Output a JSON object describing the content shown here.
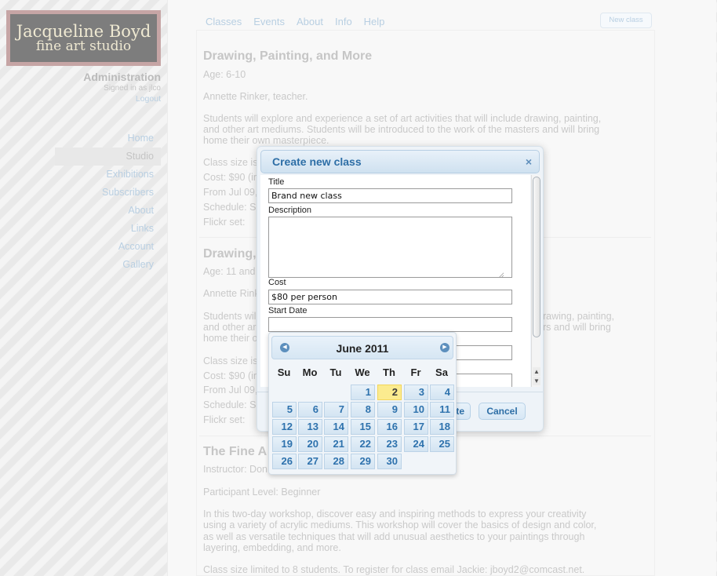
{
  "logo": {
    "line1": "Jacqueline Boyd",
    "line2": "fine art studio"
  },
  "admin": {
    "title": "Administration",
    "signed_in": "Signed in as jlco",
    "logout": "Logout"
  },
  "sidebar": {
    "items": [
      {
        "label": "Home",
        "active": false
      },
      {
        "label": "Studio",
        "active": true
      },
      {
        "label": "Exhibitions",
        "active": false
      },
      {
        "label": "Subscribers",
        "active": false
      },
      {
        "label": "About",
        "active": false
      },
      {
        "label": "Links",
        "active": false
      },
      {
        "label": "Account",
        "active": false
      },
      {
        "label": "Gallery",
        "active": false
      }
    ]
  },
  "topnav": {
    "items": [
      "Classes",
      "Events",
      "About",
      "Info",
      "Help"
    ],
    "new_class_button": "New class"
  },
  "content": {
    "class1": {
      "title": "Drawing, Painting, and More",
      "age": "Age: 6-10",
      "teacher": "Annette Rinker, teacher.",
      "desc1": "Students will explore and experience a set of art activities that will include drawing, painting,",
      "desc2": "and other art mediums. Students will be introduced to the work of the masters and will bring",
      "desc3": "home their own masterpiece.",
      "size": "Class size is",
      "cost": "Cost: $90 (in",
      "from": "From Jul 09,",
      "schedule": "Schedule: S",
      "flickr": "Flickr set:"
    },
    "class2": {
      "title": "Drawing,",
      "age": "Age: 11 and",
      "teacher": "Annette Rink",
      "desc1a": "Students will",
      "desc1b": "rawing, painting,",
      "desc2a": "and other ar",
      "desc2b": "rs and will bring",
      "desc3": "home their o",
      "size": "Class size is",
      "cost": "Cost: $90 (in",
      "from": "From Jul 09,",
      "schedule": "Schedule: S",
      "flickr": "Flickr set:"
    },
    "class3": {
      "title": "The Fine A",
      "instructor": "Instructor: Don",
      "level": "Participant Level: Beginner",
      "desc1": "In this two-day workshop, discover easy and inspiring methods to express your creativity",
      "desc2": "using a variety of acrylic mediums. This workshop will cover the basics of design and color,",
      "desc3": "as well as versatile techniques that will add unusual aesthetics to your paintings through",
      "desc4": "layering, embedding, and more.",
      "size": "Class size limited to 8 students. To register for class email Jackie: jboyd2@comcast.net."
    }
  },
  "dialog": {
    "title": "Create new class",
    "close_icon": "×",
    "fields": {
      "title_label": "Title",
      "title_value": "Brand new class",
      "description_label": "Description",
      "description_value": "",
      "cost_label": "Cost",
      "cost_value": "$80 per person",
      "start_label": "Start Date",
      "start_value": ""
    },
    "create_button_partial": "te",
    "cancel_button": "Cancel"
  },
  "datepicker": {
    "month_label": "June 2011",
    "prev_icon": "◀",
    "next_icon": "▶",
    "weekdays": [
      "Su",
      "Mo",
      "Tu",
      "We",
      "Th",
      "Fr",
      "Sa"
    ],
    "first_weekday_index": 3,
    "days_in_month": 30,
    "highlighted_day": 2
  }
}
